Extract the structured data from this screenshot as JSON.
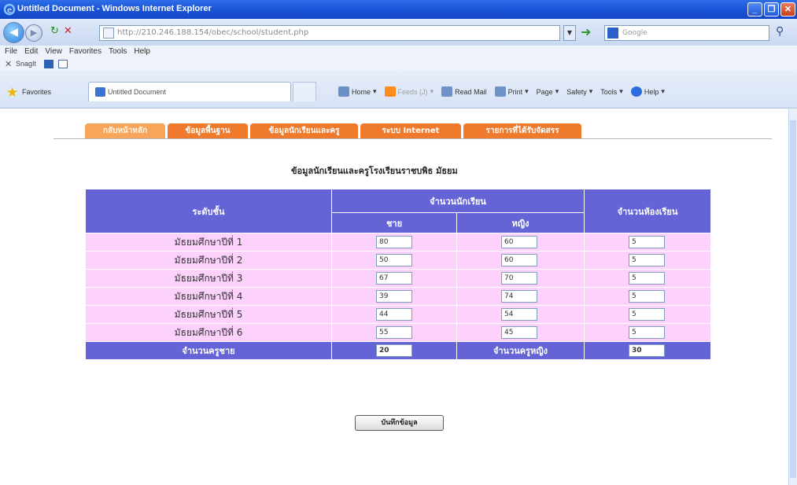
{
  "window": {
    "title": "Untitled Document - Windows Internet Explorer",
    "controls": [
      "_",
      "❐",
      "✕"
    ]
  },
  "address_bar": {
    "url": "http://210.246.188.154/obec/school/student.php",
    "search_placeholder": "Google"
  },
  "menu": [
    "File",
    "Edit",
    "View",
    "Favorites",
    "Tools",
    "Help"
  ],
  "links_bar": {
    "snagit_label": "SnagIt"
  },
  "favorites_bar": {
    "favorites_label": "Favorites",
    "tab_title": "Untitled Document",
    "commands": [
      "Home",
      "Feeds (J)",
      "Read Mail",
      "Print",
      "Page",
      "Safety",
      "Tools",
      "Help"
    ]
  },
  "nav_tabs": [
    "กลับหน้าหลัก",
    "ข้อมูลพื้นฐาน",
    "ข้อมูลนักเรียนและครู",
    "ระบบ Internet",
    "รายการที่ได้รับจัดสรร"
  ],
  "page": {
    "heading": "ข้อมูลนักเรียนและครูโรงเรียนราชบพิธ มัธยม",
    "table": {
      "col_level": "ระดับชั้น",
      "col_students": "จำนวนนักเรียน",
      "col_male": "ชาย",
      "col_female": "หญิง",
      "col_rooms": "จำนวนห้องเรียน",
      "rows": [
        {
          "level": "มัธยมศึกษาปีที่ 1",
          "male": "80",
          "female": "60",
          "rooms": "5"
        },
        {
          "level": "มัธยมศึกษาปีที่ 2",
          "male": "50",
          "female": "60",
          "rooms": "5"
        },
        {
          "level": "มัธยมศึกษาปีที่ 3",
          "male": "67",
          "female": "70",
          "rooms": "5"
        },
        {
          "level": "มัธยมศึกษาปีที่ 4",
          "male": "39",
          "female": "74",
          "rooms": "5"
        },
        {
          "level": "มัธยมศึกษาปีที่ 5",
          "male": "44",
          "female": "54",
          "rooms": "5"
        },
        {
          "level": "มัธยมศึกษาปีที่ 6",
          "male": "55",
          "female": "45",
          "rooms": "5"
        }
      ],
      "male_teachers_label": "จำนวนครูชาย",
      "male_teachers": "20",
      "female_teachers_label": "จำนวนครูหญิง",
      "female_teachers": "30"
    },
    "save_button": "บันทึกข้อมูล"
  },
  "colors": {
    "header_bg": "#6464d6",
    "row_bg": "#fcd1fc",
    "tab_orange": "#f07a2c",
    "tab_active": "#f6a55a"
  }
}
